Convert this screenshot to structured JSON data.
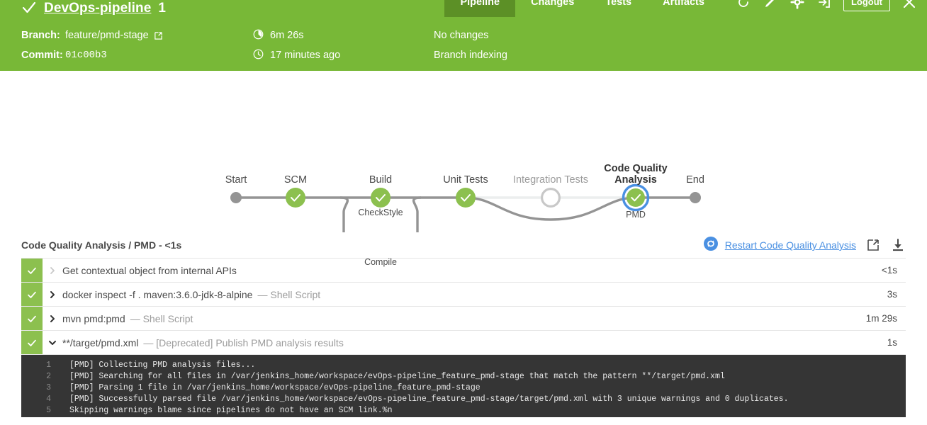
{
  "header": {
    "status_icon": "check-icon",
    "pipeline_name": "DevOps-pipeline",
    "run_number": "1",
    "tabs": [
      {
        "label": "Pipeline",
        "active": true
      },
      {
        "label": "Changes",
        "active": false
      },
      {
        "label": "Tests",
        "active": false
      },
      {
        "label": "Artifacts",
        "active": false
      }
    ],
    "icons": [
      "refresh-icon",
      "edit-pencil-icon",
      "gear-icon",
      "logout-arrow-icon"
    ],
    "logout_label": "Logout",
    "close_icon": "close-icon",
    "meta": {
      "branch_label": "Branch:",
      "branch_value": "feature/pmd-stage",
      "branch_link_icon": "external-link-icon",
      "commit_label": "Commit:",
      "commit_value": "01c00b3",
      "duration_icon": "duration-clock-icon",
      "duration_value": "6m 26s",
      "time_icon": "clock-icon",
      "time_value": "17 minutes ago",
      "changes_value": "No changes",
      "cause_value": "Branch indexing"
    },
    "colors": {
      "green": "#78b837",
      "active_tab_green": "#5c9026"
    }
  },
  "graph": {
    "stages": [
      {
        "label": "Start",
        "type": "terminal",
        "state": "done"
      },
      {
        "label": "SCM",
        "type": "node",
        "state": "success"
      },
      {
        "label": "Build",
        "type": "node",
        "state": "success"
      },
      {
        "label": "Unit Tests",
        "type": "node",
        "state": "success"
      },
      {
        "label": "Integration Tests",
        "type": "node",
        "state": "skipped"
      },
      {
        "label": "Code Quality\nAnalysis",
        "type": "node",
        "state": "success",
        "selected": true
      },
      {
        "label": "End",
        "type": "terminal",
        "state": "done"
      }
    ],
    "stage_labels": {
      "start": "Start",
      "scm": "SCM",
      "build": "Build",
      "unit_tests": "Unit Tests",
      "integration_tests": "Integration Tests",
      "code_quality_line1": "Code Quality",
      "code_quality_line2": "Analysis",
      "end": "End"
    },
    "parallel_nodes": [
      {
        "label": "CheckStyle",
        "state": "success"
      },
      {
        "label": "Compile",
        "state": "success"
      }
    ],
    "selected_node_sub": "PMD",
    "colors": {
      "success": "#8cc04f",
      "line": "#949494",
      "line_light": "#eceeee",
      "selected_ring": "#4a90e2",
      "terminal": "#949494"
    }
  },
  "results": {
    "title": "Code Quality Analysis / PMD - <1s",
    "restart_icon": "restart-replay-icon",
    "restart_label": "Restart Code Quality Analysis",
    "open_external_icon": "external-link-icon",
    "download_icon": "download-icon",
    "steps": [
      {
        "status": "success",
        "expanded": false,
        "chevron_disabled": true,
        "name": "Get contextual object from internal APIs",
        "type": "",
        "duration": "<1s"
      },
      {
        "status": "success",
        "expanded": false,
        "chevron_disabled": false,
        "name": "docker inspect -f . maven:3.6.0-jdk-8-alpine",
        "type": "— Shell Script",
        "duration": "3s"
      },
      {
        "status": "success",
        "expanded": false,
        "chevron_disabled": false,
        "name": "mvn pmd:pmd",
        "type": "— Shell Script",
        "duration": "1m 29s"
      },
      {
        "status": "success",
        "expanded": true,
        "chevron_disabled": false,
        "name": "**/target/pmd.xml",
        "type": "— [Deprecated] Publish PMD analysis results",
        "duration": "1s"
      }
    ]
  },
  "console": {
    "lines": [
      {
        "n": "1",
        "text": "[PMD] Collecting PMD analysis files..."
      },
      {
        "n": "2",
        "text": "[PMD] Searching for all files in /var/jenkins_home/workspace/evOps-pipeline_feature_pmd-stage that match the pattern **/target/pmd.xml"
      },
      {
        "n": "3",
        "text": "[PMD] Parsing 1 file in /var/jenkins_home/workspace/evOps-pipeline_feature_pmd-stage"
      },
      {
        "n": "4",
        "text": "[PMD] Successfully parsed file /var/jenkins_home/workspace/evOps-pipeline_feature_pmd-stage/target/pmd.xml with 3 unique warnings and 0 duplicates."
      },
      {
        "n": "5",
        "text": "Skipping warnings blame since pipelines do not have an SCM link.%n"
      }
    ]
  }
}
